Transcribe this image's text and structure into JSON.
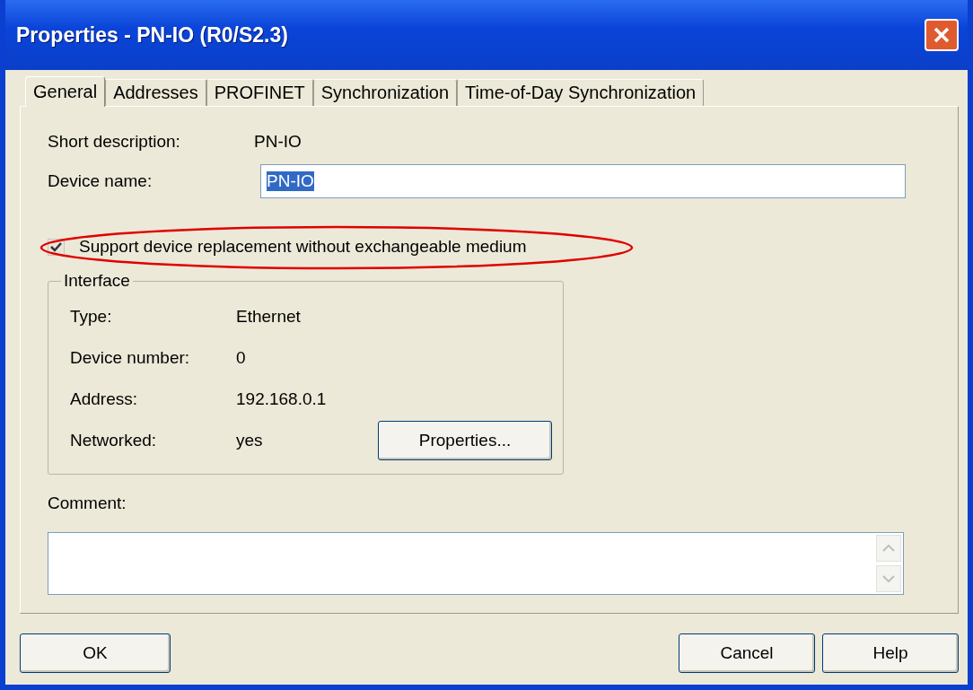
{
  "window": {
    "title": "Properties - PN-IO (R0/S2.3)"
  },
  "tabs": [
    {
      "label": "General",
      "selected": true
    },
    {
      "label": "Addresses",
      "selected": false
    },
    {
      "label": "PROFINET",
      "selected": false
    },
    {
      "label": "Synchronization",
      "selected": false
    },
    {
      "label": "Time-of-Day Synchronization",
      "selected": false
    }
  ],
  "short_description": {
    "label": "Short description:",
    "value": "PN-IO"
  },
  "device_name": {
    "label": "Device name:",
    "value": "PN-IO",
    "selected": true
  },
  "replacement_option": {
    "label": "Support device replacement without exchangeable medium",
    "checked": true,
    "disabled": true,
    "highlighted": true
  },
  "interface": {
    "title": "Interface",
    "rows": [
      {
        "label": "Type:",
        "value": "Ethernet"
      },
      {
        "label": "Device number:",
        "value": "0"
      },
      {
        "label": "Address:",
        "value": "192.168.0.1"
      },
      {
        "label": "Networked:",
        "value": "yes"
      }
    ],
    "button": "Properties..."
  },
  "comment": {
    "label": "Comment:"
  },
  "buttons": {
    "left": [
      "OK"
    ],
    "right": [
      "Cancel",
      "Help"
    ]
  }
}
